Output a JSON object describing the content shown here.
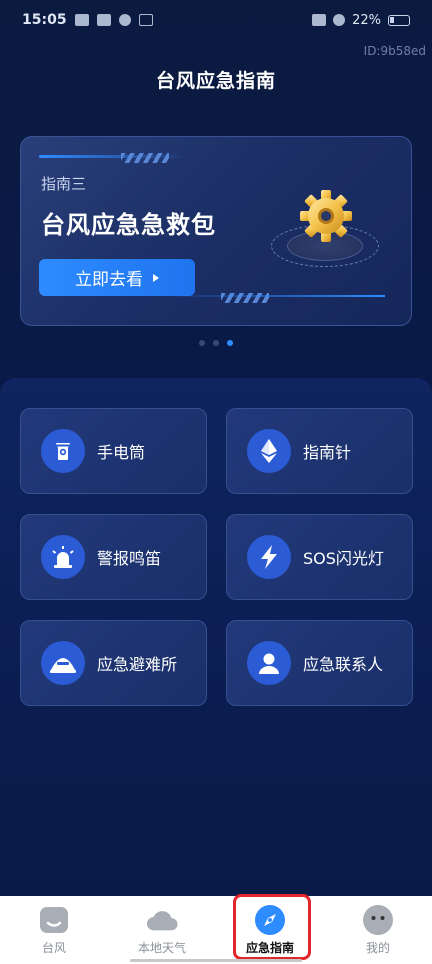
{
  "status_bar": {
    "time": "15:05",
    "battery": "22%"
  },
  "id_tag": "ID:9b58ed",
  "page_title": "台风应急指南",
  "banner": {
    "subtitle": "指南三",
    "title": "台风应急急救包",
    "button_label": "立即去看"
  },
  "carousel": {
    "count": 3,
    "active_index": 2
  },
  "cards": [
    {
      "label": "手电筒",
      "icon": "flashlight-icon"
    },
    {
      "label": "指南针",
      "icon": "compass-icon"
    },
    {
      "label": "警报鸣笛",
      "icon": "alarm-siren-icon"
    },
    {
      "label": "SOS闪光灯",
      "icon": "lightning-icon"
    },
    {
      "label": "应急避难所",
      "icon": "shelter-icon"
    },
    {
      "label": "应急联系人",
      "icon": "contact-person-icon"
    }
  ],
  "bottom_nav": [
    {
      "label": "台风",
      "icon": "typhoon-face-icon",
      "active": false
    },
    {
      "label": "本地天气",
      "icon": "cloud-icon",
      "active": false
    },
    {
      "label": "应急指南",
      "icon": "compass-nav-icon",
      "active": true
    },
    {
      "label": "我的",
      "icon": "profile-face-icon",
      "active": false
    }
  ],
  "colors": {
    "accent": "#2f8cff",
    "highlight_border": "#e3262b"
  }
}
